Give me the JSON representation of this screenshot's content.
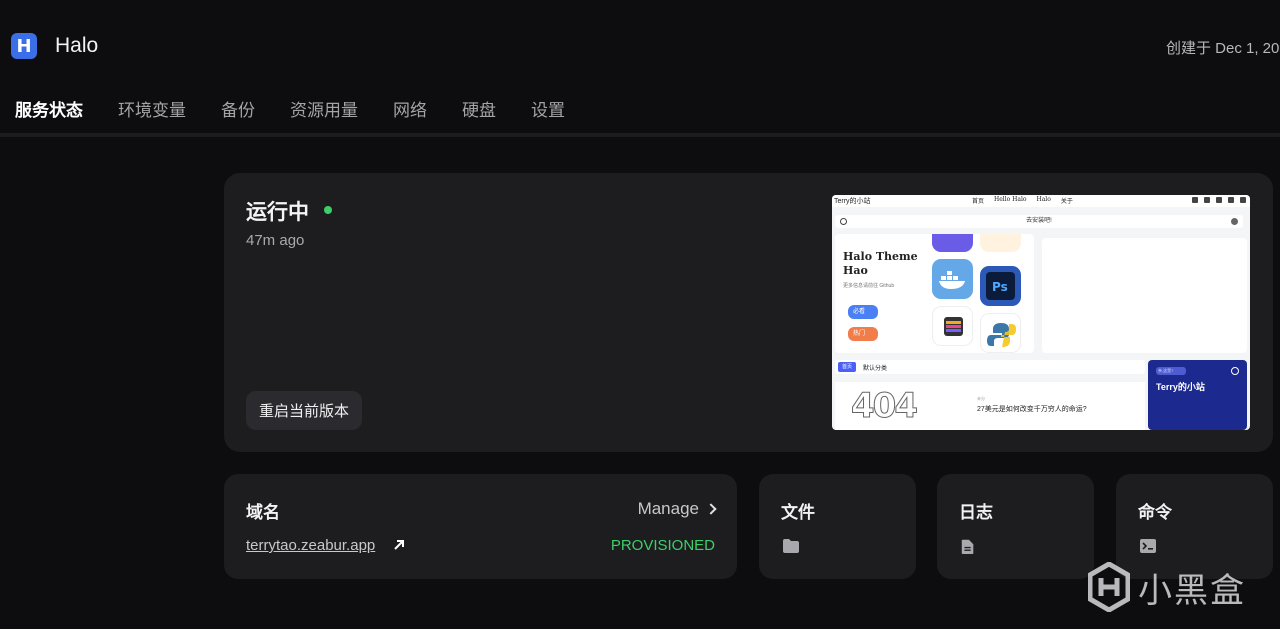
{
  "app": {
    "logo_letter": "H",
    "title": "Halo",
    "created": "创建于 Dec 1, 20"
  },
  "tabs": [
    {
      "label": "服务状态",
      "active": true
    },
    {
      "label": "环境变量"
    },
    {
      "label": "备份"
    },
    {
      "label": "资源用量"
    },
    {
      "label": "网络"
    },
    {
      "label": "硬盘"
    },
    {
      "label": "设置"
    }
  ],
  "status": {
    "title": "运行中",
    "time": "47m ago",
    "restart_label": "重启当前版本",
    "dot_color": "#3ccf68"
  },
  "preview": {
    "site_name": "Terry的小站",
    "menu": [
      "首页",
      "Hello Halo",
      "Halo",
      "关于"
    ],
    "search_text": "去安装吧!",
    "hero_title": "Halo Theme Hao",
    "hero_sub": "更多信息请前往 Github",
    "pill1": "必看",
    "pill2": "热门",
    "tag": "首页",
    "category": "默认分类",
    "post_meta": "未分",
    "post_title": "27美元是如何改变千万穷人的命运?",
    "card_chip": "亲,这是?",
    "card_title": "Terry的小站"
  },
  "domain": {
    "title": "域名",
    "manage_label": "Manage",
    "url": "terrytao.zeabur.app",
    "status": "PROVISIONED"
  },
  "cards": {
    "files": "文件",
    "logs": "日志",
    "commands": "命令"
  },
  "watermark": "小黑盒",
  "colors": {
    "accent": "#3b6fe8",
    "success": "#3ecf6a",
    "background": "#0d0d0f",
    "card": "#1d1d20"
  }
}
